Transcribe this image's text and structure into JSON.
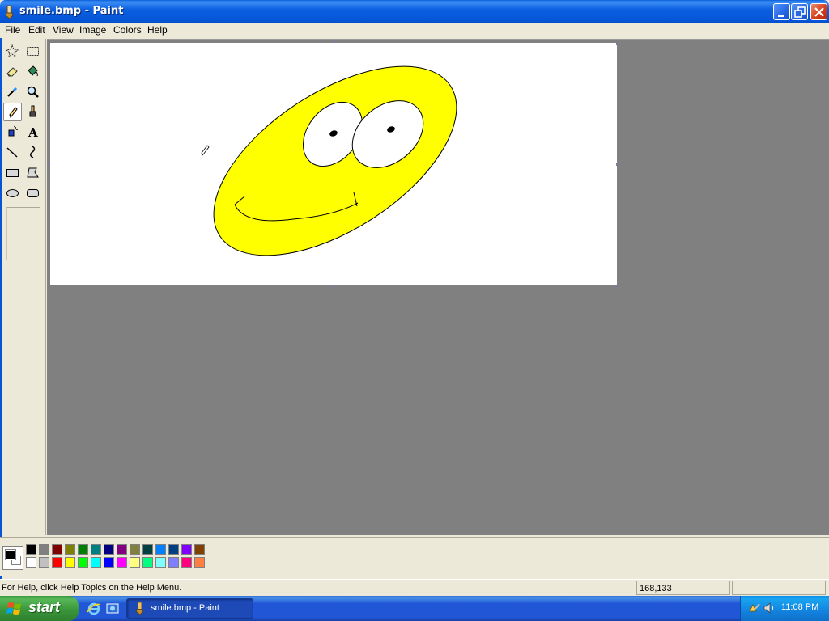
{
  "window": {
    "title": "smile.bmp - Paint"
  },
  "menu": {
    "file": "File",
    "edit": "Edit",
    "view": "View",
    "image": "Image",
    "colors": "Colors",
    "help": "Help"
  },
  "toolbox": {
    "tools": [
      {
        "name": "free-form-select-icon"
      },
      {
        "name": "select-icon"
      },
      {
        "name": "eraser-icon"
      },
      {
        "name": "fill-with-color-icon"
      },
      {
        "name": "pick-color-icon"
      },
      {
        "name": "magnifier-icon"
      },
      {
        "name": "pencil-icon",
        "active": true
      },
      {
        "name": "brush-icon"
      },
      {
        "name": "airbrush-icon"
      },
      {
        "name": "text-icon",
        "glyph": "A"
      },
      {
        "name": "line-icon"
      },
      {
        "name": "curve-icon"
      },
      {
        "name": "rectangle-icon"
      },
      {
        "name": "polygon-icon"
      },
      {
        "name": "ellipse-icon"
      },
      {
        "name": "rounded-rectangle-icon"
      }
    ]
  },
  "colors": {
    "foreground": "#000000",
    "background": "#ffffff",
    "palette_row1": [
      "#000000",
      "#808080",
      "#800000",
      "#808000",
      "#008000",
      "#008080",
      "#000080",
      "#800080",
      "#808040",
      "#004040",
      "#0080ff",
      "#004080",
      "#8000ff",
      "#804000"
    ],
    "palette_row2": [
      "#ffffff",
      "#c0c0c0",
      "#ff0000",
      "#ffff00",
      "#00ff00",
      "#00ffff",
      "#0000ff",
      "#ff00ff",
      "#ffff80",
      "#00ff80",
      "#80ffff",
      "#8080ff",
      "#ff0080",
      "#ff8040"
    ],
    "smiley_fill": "#ffff00"
  },
  "status": {
    "help_text": "For Help, click Help Topics on the Help Menu.",
    "coordinates": "168,133"
  },
  "taskbar": {
    "start_label": "start",
    "task_label": "smile.bmp - Paint",
    "clock": "11:08 PM"
  }
}
